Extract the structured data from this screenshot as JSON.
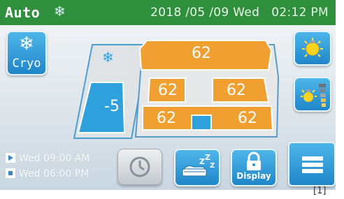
{
  "header": {
    "mode": "Auto",
    "mode_icon": "snowflake-icon",
    "datetime": "2018 /05 /09 Wed   02:12 PM"
  },
  "cryo_button": {
    "label": "Cryo",
    "icon": "snowflake-icon"
  },
  "zones": {
    "cryo_zone_icon": "snowflake-icon",
    "foot_value": "-5",
    "headrest_value": "62",
    "upper_left_value": "62",
    "upper_right_value": "62",
    "lower_left_value": "62",
    "lower_right_value": "62"
  },
  "schedule": {
    "on_time": "Wed 09:00 AM",
    "off_time": "Wed 06:00 PM"
  },
  "bottom_buttons": {
    "timer_icon": "clock-icon",
    "sleep_icon": "sleep-icon",
    "display_lock_label": "Display"
  },
  "side_buttons": {
    "light_icon": "light-bulb-icon",
    "brightness_icon": "brightness-level-icon",
    "menu_icon": "menu-icon"
  },
  "footnote": "[1]",
  "colors": {
    "header_green": "#2f8f3c",
    "orange_zone": "#f0a030",
    "blue_zone": "#2ea0dc",
    "button_blue": "#2a93d6"
  }
}
